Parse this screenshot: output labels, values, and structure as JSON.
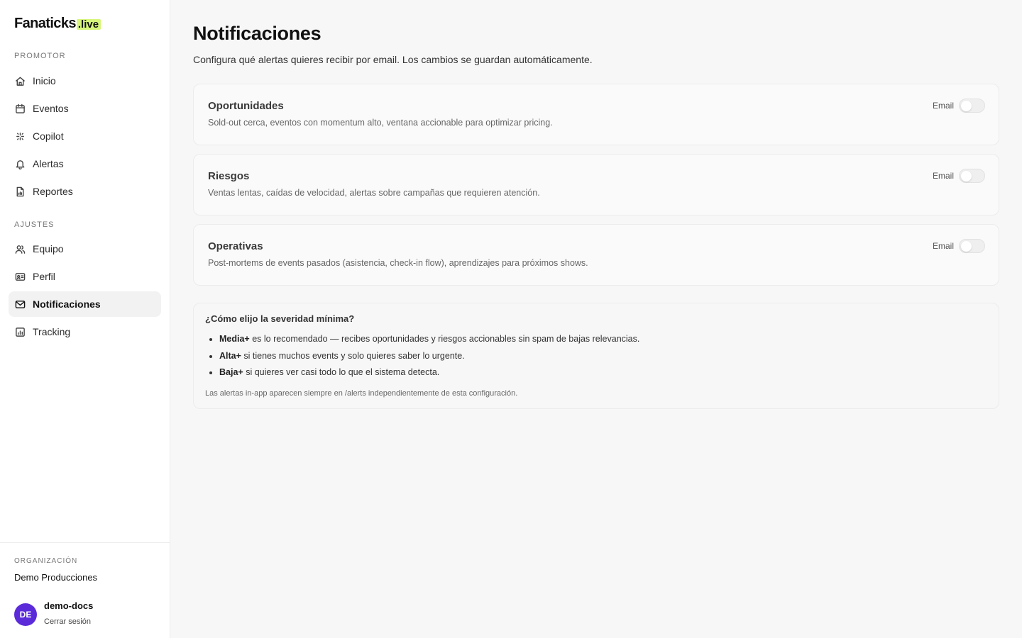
{
  "brand": {
    "name": "Fanaticks",
    "suffix": ".live",
    "accent": "#d6f57a"
  },
  "sidebar": {
    "sections": [
      {
        "label": "PROMOTOR"
      },
      {
        "label": "AJUSTES"
      }
    ],
    "items": [
      {
        "label": "Inicio",
        "icon": "home-icon"
      },
      {
        "label": "Eventos",
        "icon": "calendar-icon"
      },
      {
        "label": "Copilot",
        "icon": "sparkles-icon"
      },
      {
        "label": "Alertas",
        "icon": "bell-icon"
      },
      {
        "label": "Reportes",
        "icon": "file-chart-icon"
      },
      {
        "label": "Equipo",
        "icon": "users-icon"
      },
      {
        "label": "Perfil",
        "icon": "id-card-icon"
      },
      {
        "label": "Notificaciones",
        "icon": "mail-icon",
        "active": true
      },
      {
        "label": "Tracking",
        "icon": "bar-chart-icon"
      }
    ],
    "footer": {
      "org_label": "ORGANIZACIÓN",
      "org_name": "Demo Producciones",
      "avatar_initials": "DE",
      "avatar_color": "#5b2bd9",
      "user_name": "demo-docs",
      "logout_label": "Cerrar sesión"
    }
  },
  "main": {
    "title": "Notificaciones",
    "subtitle": "Configura qué alertas quieres recibir por email. Los cambios se guardan automáticamente.",
    "cards": [
      {
        "title": "Oportunidades",
        "description": "Sold-out cerca, eventos con momentum alto, ventana accionable para optimizar pricing.",
        "toggle_label": "Email",
        "enabled": false
      },
      {
        "title": "Riesgos",
        "description": "Ventas lentas, caídas de velocidad, alertas sobre campañas que requieren atención.",
        "toggle_label": "Email",
        "enabled": false
      },
      {
        "title": "Operativas",
        "description": "Post-mortems de events pasados (asistencia, check-in flow), aprendizajes para próximos shows.",
        "toggle_label": "Email",
        "enabled": false
      }
    ],
    "info": {
      "title": "¿Cómo elijo la severidad mínima?",
      "items": [
        {
          "bold": "Media+",
          "text": " es lo recomendado — recibes oportunidades y riesgos accionables sin spam de bajas relevancias."
        },
        {
          "bold": "Alta+",
          "text": " si tienes muchos events y solo quieres saber lo urgente."
        },
        {
          "bold": "Baja+",
          "text": " si quieres ver casi todo lo que el sistema detecta."
        }
      ],
      "note": "Las alertas in-app aparecen siempre en /alerts independientemente de esta configuración."
    }
  }
}
